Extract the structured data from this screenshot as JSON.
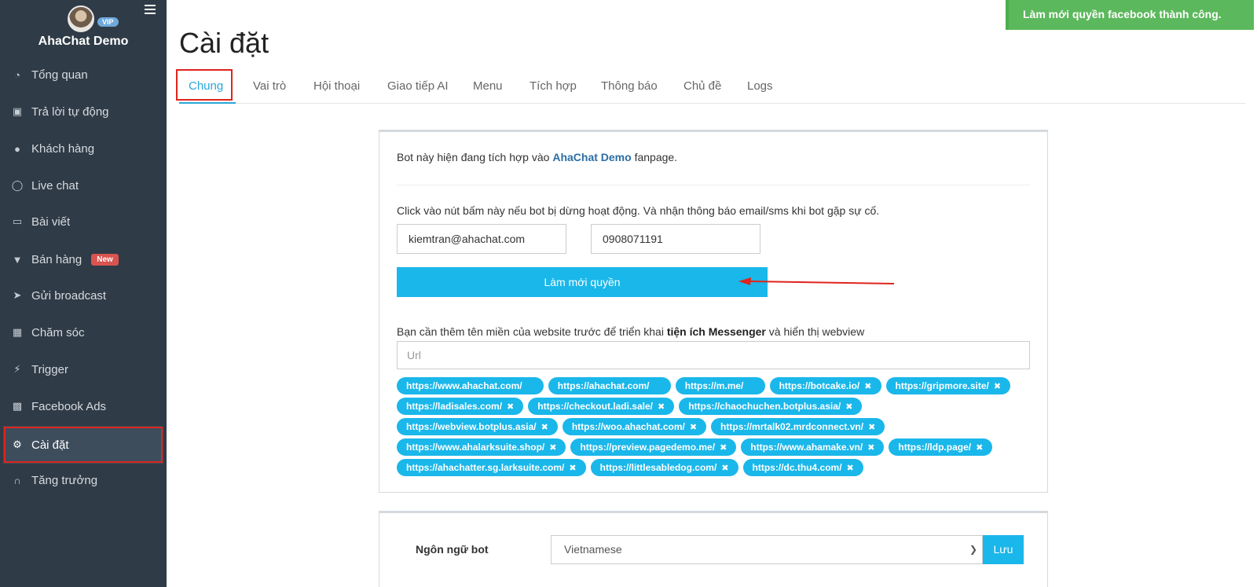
{
  "sidebar": {
    "brand_name": "AhaChat Demo",
    "vip_badge": "VIP",
    "items": [
      {
        "label": "Tổng quan",
        "icon": "dashboard-icon"
      },
      {
        "label": "Trả lời tự động",
        "icon": "sitemap-icon"
      },
      {
        "label": "Khách hàng",
        "icon": "user-icon"
      },
      {
        "label": "Live chat",
        "icon": "chat-bubble-icon"
      },
      {
        "label": "Bài viết",
        "icon": "book-icon"
      },
      {
        "label": "Bán hàng",
        "icon": "cart-icon",
        "badge": "New"
      },
      {
        "label": "Gửi broadcast",
        "icon": "paper-plane-icon"
      },
      {
        "label": "Chăm sóc",
        "icon": "calendar-icon"
      },
      {
        "label": "Trigger",
        "icon": "bolt-icon"
      },
      {
        "label": "Facebook Ads",
        "icon": "facebook-square-icon"
      },
      {
        "label": "Cài đặt",
        "icon": "gear-icon",
        "active": true
      },
      {
        "label": "Tăng trưởng",
        "icon": "magnet-icon"
      }
    ]
  },
  "header": {
    "title": "Cài đặt",
    "tabs": [
      "Chung",
      "Vai trò",
      "Hội thoại",
      "Giao tiếp AI",
      "Menu",
      "Tích hợp",
      "Thông báo",
      "Chủ đề",
      "Logs"
    ],
    "active_tab": "Chung"
  },
  "toast": {
    "message": "Làm mới quyền facebook thành công."
  },
  "general": {
    "intro_prefix": "Bot này hiện đang tích hợp vào",
    "page_name": "AhaChat Demo",
    "intro_suffix": "fanpage.",
    "refresh_hint": "Click vào nút bấm này nếu bot bị dừng hoạt động. Và nhận thông báo email/sms khi bot gặp sự cố.",
    "email_value": "kiemtran@ahachat.com",
    "phone_value": "0908071191",
    "refresh_button": "Làm mới quyền",
    "domain_hint_prefix": "Bạn cần thêm tên miền của website trước để triển khai",
    "domain_hint_bold": "tiện ích Messenger",
    "domain_hint_suffix": "và hiển thị webview",
    "url_placeholder": "Url",
    "domains": [
      [
        "https://www.ahachat.com/",
        "https://ahachat.com/",
        "https://m.me/",
        "https://botcake.io/",
        "https://gripmore.site/"
      ],
      [
        "https://ladisales.com/",
        "https://checkout.ladi.sale/",
        "https://chaochuchen.botplus.asia/"
      ],
      [
        "https://webview.botplus.asia/",
        "https://woo.ahachat.com/",
        "https://mrtalk02.mrdconnect.vn/"
      ],
      [
        "https://www.ahalarksuite.shop/",
        "https://preview.pagedemo.me/",
        "https://www.ahamake.vn/",
        "https://ldp.page/"
      ],
      [
        "https://ahachatter.sg.larksuite.com/",
        "https://littlesabledog.com/",
        "https://dc.thu4.com/"
      ]
    ],
    "chip_close_glyph": "✖"
  },
  "language": {
    "label": "Ngôn ngữ bot",
    "selected": "Vietnamese",
    "save_button": "Lưu"
  },
  "colors": {
    "sidebar_bg": "#2f3b47",
    "accent": "#1ab7ea",
    "toast_bg": "#5cb85c",
    "highlight_red": "#e0241b",
    "badge_new": "#d9534f"
  }
}
